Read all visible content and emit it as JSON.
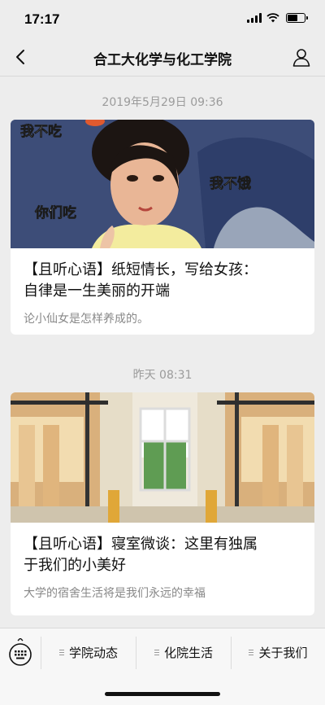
{
  "status": {
    "time": "17:17"
  },
  "nav": {
    "title": "合工大化学与化工学院"
  },
  "articles": [
    {
      "timestamp": "2019年5月29日 09:36",
      "image_captions": [
        "我不吃",
        "我不饿",
        "你们吃"
      ],
      "title_line1": "【且听心语】纸短情长，写给女孩：",
      "title_line2": "自律是一生美丽的开端",
      "summary": "论小仙女是怎样养成的。"
    },
    {
      "timestamp": "昨天 08:31",
      "title_line1": "【且听心语】寝室微谈：这里有独属",
      "title_line2": "于我们的小美好",
      "summary": "大学的宿舍生活将是我们永远的幸福"
    }
  ],
  "bottom_menu": {
    "keyboard_icon": "keyboard-icon",
    "tabs": [
      {
        "label": "学院动态"
      },
      {
        "label": "化院生活"
      },
      {
        "label": "关于我们"
      }
    ]
  },
  "colors": {
    "background": "#ededed",
    "card": "#ffffff",
    "muted_text": "#888888"
  }
}
